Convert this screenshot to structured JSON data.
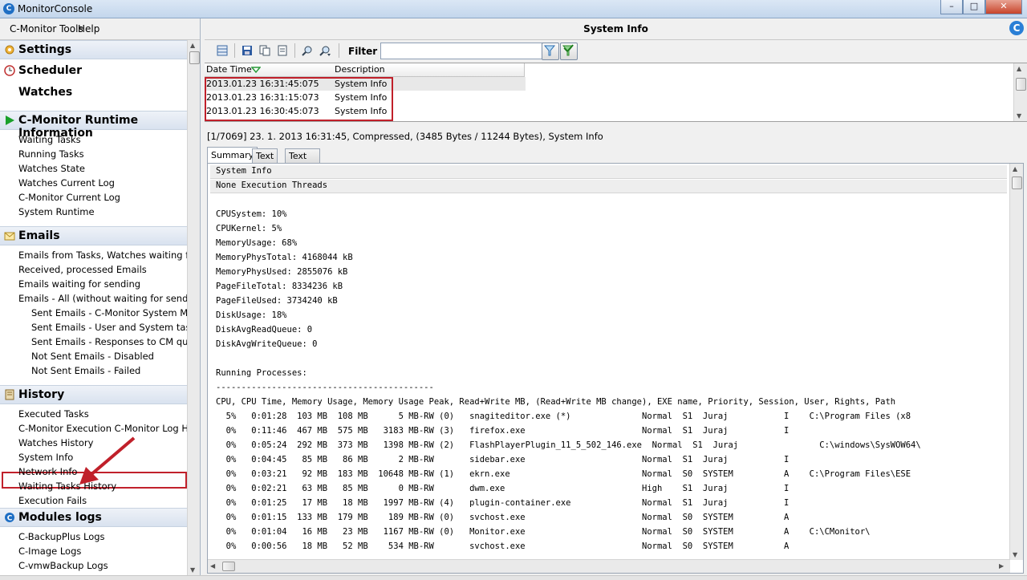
{
  "window": {
    "title": "MonitorConsole",
    "minimize": "–",
    "maximize": "□",
    "close": "✕"
  },
  "menu": [
    "C-Monitor Tools",
    "Help"
  ],
  "sidebar": {
    "settings": "Settings",
    "scheduler": "Scheduler",
    "watches": "Watches",
    "runtime": {
      "header": "C-Monitor Runtime Information",
      "items": [
        "Waiting Tasks",
        "Running Tasks",
        "Watches State",
        "Watches Current Log",
        "C-Monitor Current Log",
        "System Runtime"
      ]
    },
    "emails": {
      "header": "Emails",
      "items": [
        "Emails from Tasks, Watches waiting for send",
        "Received, processed Emails",
        "Emails waiting for sending",
        "Emails - All (without waiting for sending)"
      ],
      "subitems": [
        "Sent Emails - C-Monitor System Message",
        "Sent Emails - User and System tasks Res",
        "Sent Emails - Responses to CM queries",
        "Not Sent Emails - Disabled",
        "Not Sent Emails - Failed"
      ]
    },
    "history": {
      "header": "History",
      "items": [
        "Executed Tasks",
        "C-Monitor Execution C-Monitor Log History",
        "Watches History",
        "System Info",
        "Network Info",
        "Waiting Tasks History",
        "Execution Fails"
      ]
    },
    "modules": {
      "header": "Modules logs",
      "items": [
        "C-BackupPlus Logs",
        "C-Image Logs",
        "C-vmwBackup Logs"
      ]
    }
  },
  "panel": {
    "title": "System Info",
    "filter_label": "Filter",
    "filter_value": "",
    "grid": {
      "columns": [
        "Date Time",
        "Description"
      ],
      "rows": [
        [
          "2013.01.23   16:31:45:075",
          "System Info"
        ],
        [
          "2013.01.23   16:31:15:073",
          "System Info"
        ],
        [
          "2013.01.23   16:30:45:073",
          "System Info"
        ]
      ]
    },
    "info_line": "[1/7069]   23. 1. 2013 16:31:45, Compressed, (3485 Bytes / 11244 Bytes), System Info",
    "tabs": [
      "Summary",
      "Text",
      "Text Series"
    ],
    "content": {
      "header1": "System Info",
      "header2": "None Execution Threads",
      "stats": [
        "CPUSystem: 10%",
        "CPUKernel: 5%",
        "MemoryUsage: 68%",
        "MemoryPhysTotal: 4168044 kB",
        "MemoryPhysUsed: 2855076 kB",
        "PageFileTotal: 8334236 kB",
        "PageFileUsed: 3734240 kB",
        "DiskUsage: 18%",
        "DiskAvgReadQueue: 0",
        "DiskAvgWriteQueue: 0"
      ],
      "running_title": "Running Processes:",
      "dashes": "-------------------------------------------",
      "columns_line": "CPU, CPU Time, Memory Usage, Memory Usage Peak, Read+Write MB, (Read+Write MB change), EXE name, Priority, Session, User, Rights, Path",
      "processes": [
        "  5%   0:01:28  103 MB  108 MB      5 MB-RW (0)   snagiteditor.exe (*)              Normal  S1  Juraj           I    C:\\Program Files (x8",
        "  0%   0:11:46  467 MB  575 MB   3183 MB-RW (3)   firefox.exe                       Normal  S1  Juraj           I",
        "  0%   0:05:24  292 MB  373 MB   1398 MB-RW (2)   FlashPlayerPlugin_11_5_502_146.exe  Normal  S1  Juraj                C:\\windows\\SysWOW64\\",
        "  0%   0:04:45   85 MB   86 MB      2 MB-RW       sidebar.exe                       Normal  S1  Juraj           I",
        "  0%   0:03:21   92 MB  183 MB  10648 MB-RW (1)   ekrn.exe                          Normal  S0  SYSTEM          A    C:\\Program Files\\ESE",
        "  0%   0:02:21   63 MB   85 MB      0 MB-RW       dwm.exe                           High    S1  Juraj           I",
        "  0%   0:01:25   17 MB   18 MB   1997 MB-RW (4)   plugin-container.exe              Normal  S1  Juraj           I",
        "  0%   0:01:15  133 MB  179 MB    189 MB-RW (0)   svchost.exe                       Normal  S0  SYSTEM          A",
        "  0%   0:01:04   16 MB   23 MB   1167 MB-RW (0)   Monitor.exe                       Normal  S0  SYSTEM          A    C:\\CMonitor\\",
        "  0%   0:00:56   18 MB   52 MB    534 MB-RW       svchost.exe                       Normal  S0  SYSTEM          A"
      ]
    }
  },
  "colors": {
    "annotation_red": "#c0202a",
    "section_header": "#d9e2ef",
    "runtime_icon": "#1aa02a"
  }
}
